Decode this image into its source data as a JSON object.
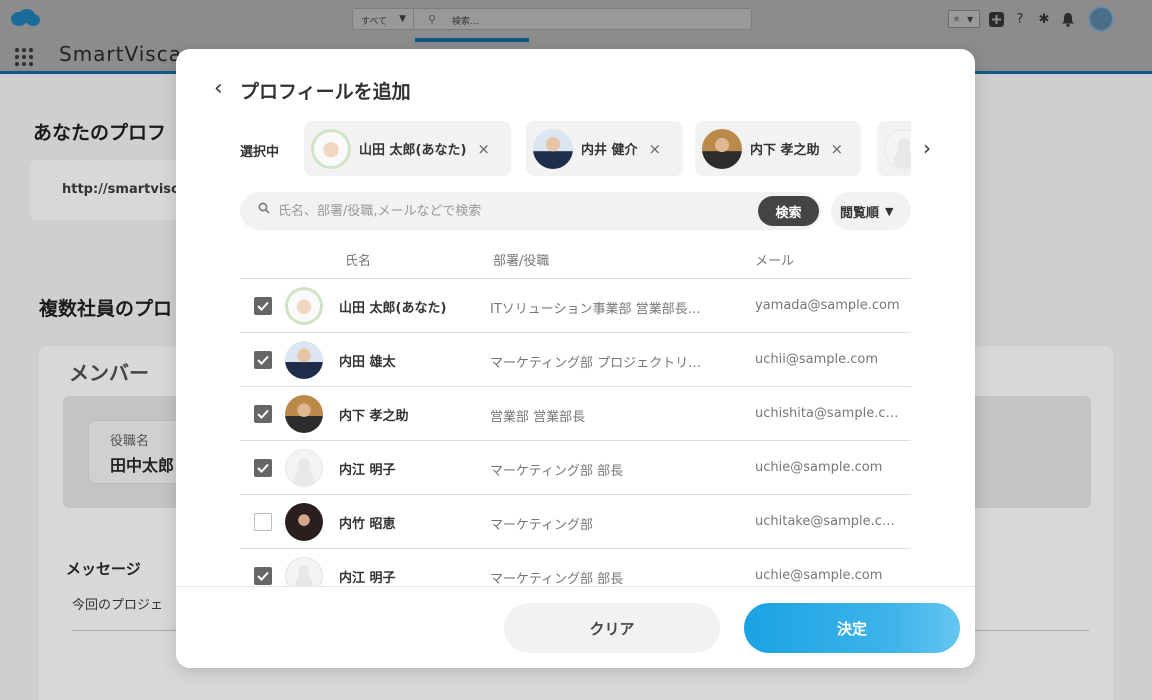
{
  "header": {
    "search_scope": "すべて",
    "search_placeholder": "検索...",
    "app_name": "SmartVisca"
  },
  "background": {
    "profile_heading": "あなたのプロフ",
    "profile_url": "http://smartvisca",
    "multi_heading": "複数社員のプロ",
    "members_heading": "メンバー",
    "job_title_label": "役職名",
    "job_title_value": "田中太郎",
    "message_heading": "メッセージ",
    "message_text": "今回のプロジェ"
  },
  "modal": {
    "title": "プロフィールを追加",
    "selected_label": "選択中",
    "selected_chips": [
      {
        "name": "山田 太郎(あなた)",
        "avatar": "plant"
      },
      {
        "name": "内井 健介",
        "avatar": "suit"
      },
      {
        "name": "内下 孝之助",
        "avatar": "office"
      },
      {
        "name": "",
        "avatar": "default"
      }
    ],
    "search": {
      "placeholder": "氏名、部署/役職,メールなどで検索",
      "button_label": "検索"
    },
    "sort_label": "閲覧順",
    "columns": {
      "name": "氏名",
      "dept": "部署/役職",
      "mail": "メール"
    },
    "rows": [
      {
        "checked": true,
        "name": "山田 太郎(あなた)",
        "dept": "ITソリューション事業部 営業部長…",
        "mail": "yamada@sample.com",
        "avatar": "plant"
      },
      {
        "checked": true,
        "name": "内田 雄太",
        "dept": "マーケティング部 プロジェクトリ…",
        "mail": "uchii@sample.com",
        "avatar": "suit"
      },
      {
        "checked": true,
        "name": "内下 孝之助",
        "dept": "営業部 営業部長",
        "mail": "uchishita@sample.c…",
        "avatar": "office"
      },
      {
        "checked": true,
        "name": "内江 明子",
        "dept": "マーケティング部 部長",
        "mail": "uchie@sample.com",
        "avatar": "default"
      },
      {
        "checked": false,
        "name": "内竹 昭恵",
        "dept": "マーケティング部",
        "mail": "uchitake@sample.c…",
        "avatar": "dark"
      },
      {
        "checked": true,
        "name": "内江 明子",
        "dept": "マーケティング部 部長",
        "mail": "uchie@sample.com",
        "avatar": "default"
      }
    ],
    "clear_label": "クリア",
    "confirm_label": "決定"
  },
  "colors": {
    "accent": "#1aa3e3",
    "checkbox_checked": "#666666",
    "search_button": "#444444"
  }
}
